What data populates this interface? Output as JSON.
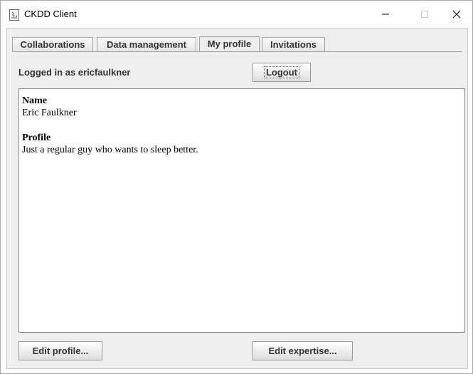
{
  "window": {
    "title": "CKDD Client",
    "app_icon": "java-app-icon",
    "controls": {
      "minimize_icon": "minimize-icon",
      "maximize_icon": "maximize-icon",
      "close_icon": "close-icon"
    }
  },
  "tabs": [
    {
      "label": "Collaborations",
      "active": false
    },
    {
      "label": "Data management",
      "active": false
    },
    {
      "label": "My profile",
      "active": true
    },
    {
      "label": "Invitations",
      "active": false
    }
  ],
  "header": {
    "logged_in_text": "Logged in as ericfaulkner",
    "logout_label": "Logout"
  },
  "profile": {
    "name_heading": "Name",
    "name_value": "Eric Faulkner",
    "profile_heading": "Profile",
    "profile_value": "Just a regular guy who wants to sleep better."
  },
  "footer": {
    "edit_profile_label": "Edit profile...",
    "edit_expertise_label": "Edit expertise..."
  }
}
